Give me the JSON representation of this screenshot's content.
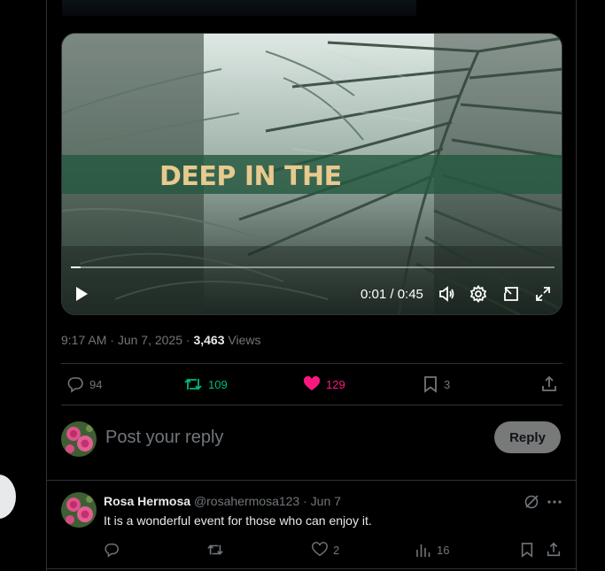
{
  "video": {
    "overlay_text": "DEEP IN THE",
    "time_display": "0:01 / 0:45",
    "progress_fraction": 0.02
  },
  "post_meta": {
    "time": "9:17 AM",
    "date": "Jun 7, 2025",
    "views_count": "3,463",
    "views_label": "Views"
  },
  "actions": {
    "replies": "94",
    "reposts": "109",
    "likes": "129",
    "bookmarks": "3"
  },
  "composer": {
    "placeholder": "Post your reply",
    "reply_label": "Reply"
  },
  "comment": {
    "name": "Rosa Hermosa",
    "handle": "@rosahermosa123",
    "date": "Jun 7",
    "text": "It is a wonderful event for those who can enjoy it.",
    "likes": "2",
    "views": "16"
  },
  "colors": {
    "accent_green": "#00ba7c",
    "accent_pink": "#f91880",
    "muted": "#71767b",
    "border": "#2f3336"
  }
}
